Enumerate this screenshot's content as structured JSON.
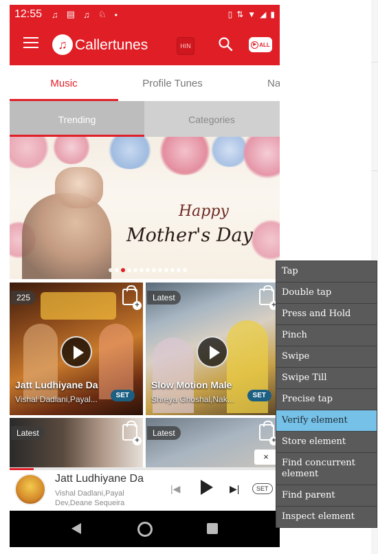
{
  "status_bar": {
    "time": "12:55"
  },
  "app_bar": {
    "title": "Callertunes",
    "lang_button": "HIN",
    "all_button": "ALL"
  },
  "tabs": [
    {
      "label": "Music"
    },
    {
      "label": "Profile Tunes"
    },
    {
      "label": "Name"
    }
  ],
  "subtabs": [
    {
      "label": "Trending"
    },
    {
      "label": "Categories"
    }
  ],
  "banner": {
    "line1": "Happy",
    "line2": "Mother's Day"
  },
  "cards": [
    {
      "badge": "225",
      "title": "Jatt Ludhiyane Da",
      "artist": "Vishal Dadlani,Payal...",
      "set_label": "SET"
    },
    {
      "badge": "Latest",
      "title": "Slow Motion Male",
      "artist": "Shreya Ghoshal,Nak...",
      "set_label": "SET"
    },
    {
      "badge": "Latest"
    },
    {
      "badge": "Latest"
    }
  ],
  "mini_player": {
    "title": "Jatt Ludhiyane Da",
    "artist": "Vishal Dadlani,Payal Dev,Deane Sequeira",
    "set_label": "SET",
    "progress": 0.09
  },
  "close_label": "×",
  "context_menu": {
    "items": [
      {
        "label": "Tap"
      },
      {
        "label": "Double tap"
      },
      {
        "label": "Press and Hold"
      },
      {
        "label": "Pinch"
      },
      {
        "label": "Swipe"
      },
      {
        "label": "Swipe Till"
      },
      {
        "label": "Precise tap"
      },
      {
        "label": "Verify element"
      },
      {
        "label": "Store element"
      },
      {
        "label": "Find concurrent element"
      },
      {
        "label": "Find parent"
      },
      {
        "label": "Inspect element"
      }
    ],
    "selected_index": 7
  },
  "colors": {
    "brand_red": "#e01e26",
    "menu_bg": "#5a5a5a",
    "menu_selected": "#76c1e8",
    "set_blue": "#1b5f83"
  }
}
